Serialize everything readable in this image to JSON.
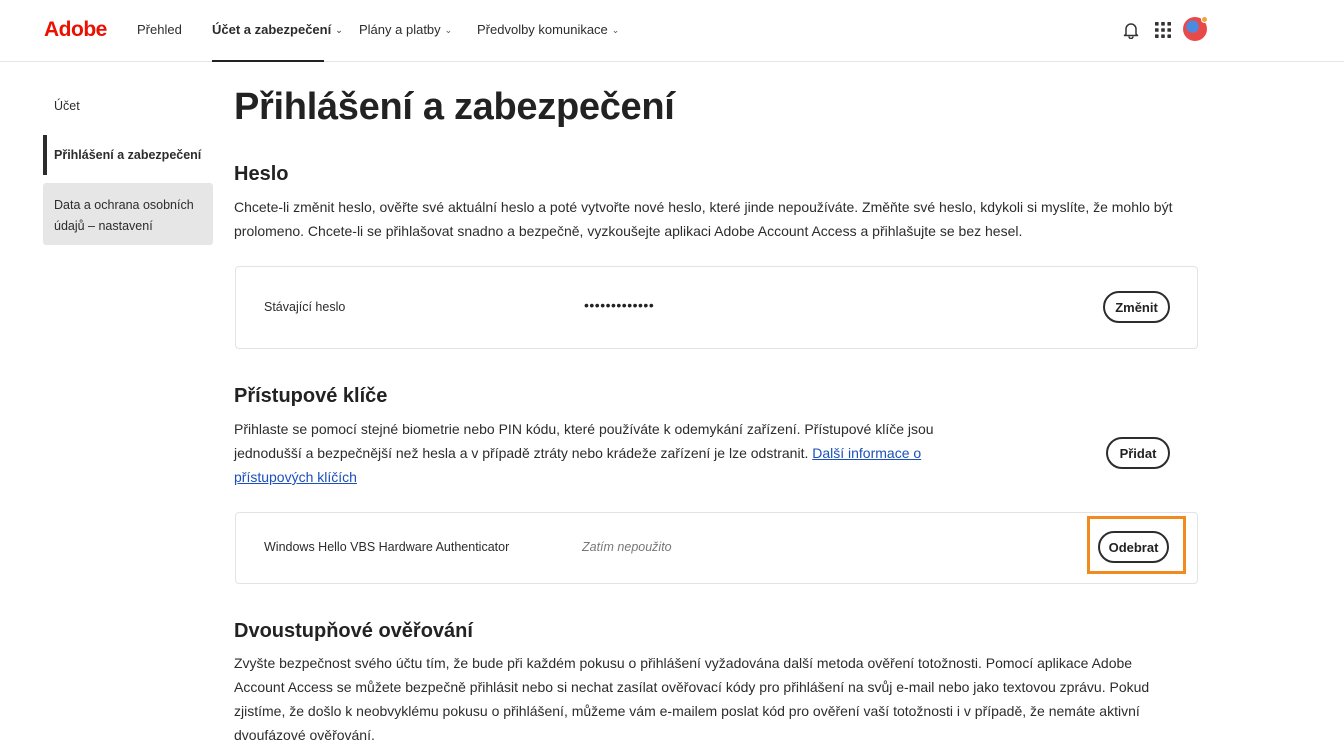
{
  "brand": {
    "logo_text": "Adobe",
    "logo_color": "#eb1000"
  },
  "nav": {
    "items": [
      {
        "label": "Přehled",
        "has_dropdown": false,
        "active": false
      },
      {
        "label": "Účet a zabezpečení",
        "has_dropdown": true,
        "active": true
      },
      {
        "label": "Plány a platby",
        "has_dropdown": true,
        "active": false
      },
      {
        "label": "Předvolby komunikace",
        "has_dropdown": true,
        "active": false
      }
    ],
    "icons": [
      "bell-icon",
      "apps-grid-icon",
      "avatar"
    ]
  },
  "sidebar": {
    "items": [
      {
        "label": "Účet",
        "active": false
      },
      {
        "label": "Přihlášení a zabezpečení",
        "active": true
      },
      {
        "label": "Data a ochrana osobních údajů – nastavení",
        "active": false
      }
    ]
  },
  "page": {
    "title": "Přihlášení a zabezpečení"
  },
  "password": {
    "title": "Heslo",
    "description": "Chcete-li změnit heslo, ověřte své aktuální heslo a poté vytvořte nové heslo, které jinde nepoužíváte. Změňte své heslo, kdykoli si myslíte, že mohlo být prolomeno. Chcete-li se přihlašovat snadno a bezpečně, vyzkoušejte aplikaci Adobe Account Access a přihlašujte se bez hesel.",
    "current_label": "Stávající heslo",
    "current_value": "•••••••••••••",
    "change_button": "Změnit"
  },
  "passkeys": {
    "title": "Přístupové klíče",
    "description": "Přihlaste se pomocí stejné biometrie nebo PIN kódu, které používáte k odemykání zařízení. Přístupové klíče jsou jednodušší a bezpečnější než hesla a v případě ztráty nebo krádeže zařízení je lze odstranit.",
    "link": "Další informace o přístupových klíčích",
    "add_button": "Přidat",
    "entry": {
      "name": "Windows Hello VBS Hardware Authenticator",
      "status": "Zatím nepoužito",
      "remove_button": "Odebrat"
    },
    "highlight_color": "#f28b1f"
  },
  "two_factor": {
    "title": "Dvoustupňové ověřování",
    "description": "Zvyšte bezpečnost svého účtu tím, že bude při každém pokusu o přihlášení vyžadována další metoda ověření totožnosti. Pomocí aplikace Adobe Account Access se můžete bezpečně přihlásit nebo si nechat zasílat ověřovací kódy pro přihlášení na svůj e-mail nebo jako textovou zprávu. Pokud zjistíme, že došlo k neobvyklému pokusu o přihlášení, můžeme vám e-mailem poslat kód pro ověření vaší totožnosti i v případě, že nemáte aktivní dvoufázové ověřování."
  }
}
